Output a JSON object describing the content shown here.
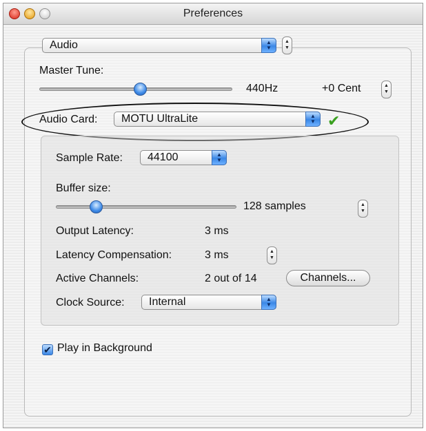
{
  "window": {
    "title": "Preferences"
  },
  "section_popup": {
    "value": "Audio"
  },
  "master_tune": {
    "label": "Master Tune:",
    "frequency": "440Hz",
    "cent": "+0 Cent",
    "slider_level": 0.52
  },
  "audio_card": {
    "label": "Audio Card:",
    "value": "MOTU UltraLite",
    "status_icon": "checkmark-icon"
  },
  "sample_rate": {
    "label": "Sample Rate:",
    "value": "44100"
  },
  "buffer": {
    "label": "Buffer size:",
    "value": "128 samples",
    "slider_level": 0.22
  },
  "output_latency": {
    "label": "Output Latency:",
    "value": "3 ms"
  },
  "latency_compensation": {
    "label": "Latency Compensation:",
    "value": "3 ms"
  },
  "active_channels": {
    "label": "Active Channels:",
    "value": "2 out of 14",
    "button": "Channels..."
  },
  "clock_source": {
    "label": "Clock Source:",
    "value": "Internal"
  },
  "play_in_background": {
    "label": "Play in Background",
    "checked": true
  },
  "colors": {
    "accent": "#3a87e6",
    "check_green": "#3aa020"
  }
}
